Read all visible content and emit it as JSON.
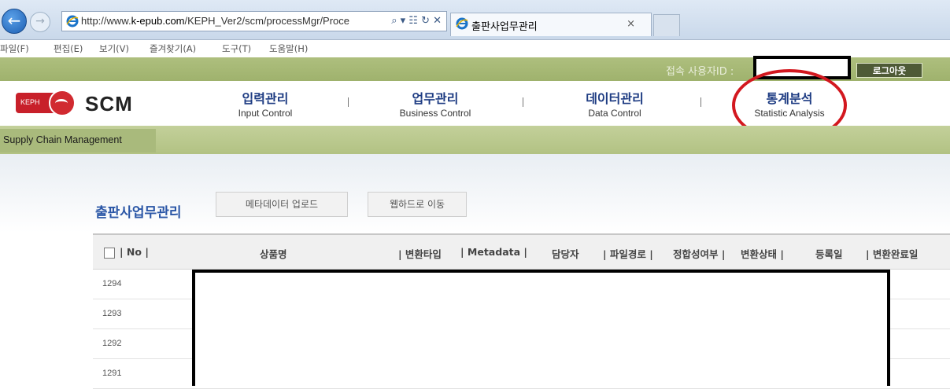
{
  "browser": {
    "url_prefix": "http://www.",
    "url_domain": "k-epub.com",
    "url_rest": "/KEPH_Ver2/scm/processMgr/Proce",
    "address_tools": "⌕ ▾ ☷ ↻ ✕",
    "tab_title": "출판사업무관리",
    "tab_close": "×",
    "menu": [
      "파일(F)",
      "편집(E)",
      "보기(V)",
      "즐겨찾기(A)",
      "도구(T)",
      "도움말(H)"
    ]
  },
  "site": {
    "conn_label": "접속 사용자ID :",
    "logout_label": "로그아웃",
    "logo_badge": "KEPH",
    "logo_text": "SCM",
    "tagline": "Supply Chain Management",
    "nav": [
      {
        "ko": "입력관리",
        "en": "Input Control"
      },
      {
        "ko": "업무관리",
        "en": "Business Control"
      },
      {
        "ko": "데이터관리",
        "en": "Data Control"
      },
      {
        "ko": "통계분석",
        "en": "Statistic Analysis"
      }
    ]
  },
  "page": {
    "title": "출판사업무관리",
    "buttons": [
      "메타데이터 업로드",
      "웹하드로 이동"
    ]
  },
  "table": {
    "headers": [
      "| No |",
      "상품명",
      "| 변환타입",
      "| Metadata |",
      "담당자",
      "| 파일경로 |",
      "정합성여부 |",
      "변환상태 |",
      "등록일",
      "| 변환완료일"
    ],
    "rows": [
      "1294",
      "1293",
      "1292",
      "1291"
    ]
  },
  "colors": {
    "annotation": "#d3181f",
    "brand_green": "#aebf7e",
    "title_blue": "#2a56a6"
  }
}
